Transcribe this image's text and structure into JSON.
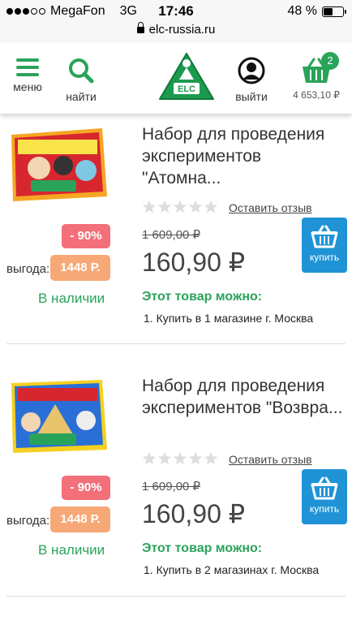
{
  "status_bar": {
    "carrier": "MegaFon",
    "network": "3G",
    "time": "17:46",
    "battery": "48 %",
    "battery_level": 0.48
  },
  "url_bar": {
    "url": "elc-russia.ru"
  },
  "header": {
    "menu_label": "меню",
    "search_label": "найти",
    "logo_text": "ELC",
    "logout_label": "выйти",
    "cart_count": "2",
    "cart_total": "4 653,10 ₽"
  },
  "colors": {
    "accent_green": "#2aa35a",
    "buy_blue": "#1f93d6",
    "discount_red": "#f36f79",
    "benefit_orange": "#f7a877"
  },
  "products": [
    {
      "title": "Набор для проведения экспериментов \"Атомна...",
      "review_link": "Оставить отзыв",
      "discount": "- 90%",
      "benefit_label": "выгода:",
      "benefit": "1448 Р.",
      "stock": "В наличии",
      "old_price": "1 609,00 ₽",
      "price": "160,90 ₽",
      "buy_label": "купить",
      "availability_title": "Этот товар можно:",
      "availability_item": "1.  Купить в 1 магазине г. Москва"
    },
    {
      "title": "Набор для проведения экспериментов \"Возвра...",
      "review_link": "Оставить отзыв",
      "discount": "- 90%",
      "benefit_label": "выгода:",
      "benefit": "1448 Р.",
      "stock": "В наличии",
      "old_price": "1 609,00 ₽",
      "price": "160,90 ₽",
      "buy_label": "купить",
      "availability_title": "Этот товар можно:",
      "availability_item": "1.  Купить в 2 магазинах г. Москва"
    }
  ]
}
